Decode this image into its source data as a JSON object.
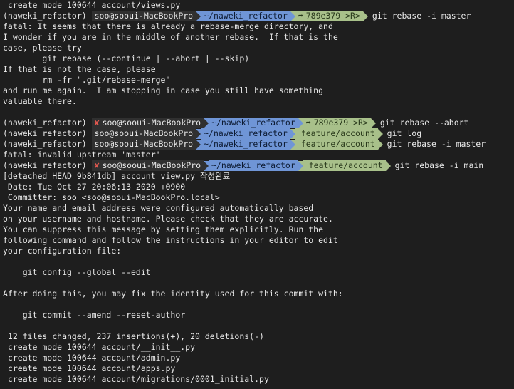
{
  "lines": [
    {
      "t": "text",
      "text": " create mode 100644 account/views.py"
    },
    {
      "t": "prompt",
      "env": "(naweki_refactor) ",
      "error": false,
      "user": "soo@sooui-MacBookPro",
      "dir": "~/naweki_refactor",
      "git": "789e379 >R>",
      "git_icon": "commit",
      "cmd": "git rebase -i master"
    },
    {
      "t": "text",
      "text": "fatal: It seems that there is already a rebase-merge directory, and"
    },
    {
      "t": "text",
      "text": "I wonder if you are in the middle of another rebase.  If that is the"
    },
    {
      "t": "text",
      "text": "case, please try"
    },
    {
      "t": "text",
      "text": "        git rebase (--continue | --abort | --skip)"
    },
    {
      "t": "text",
      "text": "If that is not the case, please"
    },
    {
      "t": "text",
      "text": "        rm -fr \".git/rebase-merge\""
    },
    {
      "t": "text",
      "text": "and run me again.  I am stopping in case you still have something"
    },
    {
      "t": "text",
      "text": "valuable there."
    },
    {
      "t": "text",
      "text": ""
    },
    {
      "t": "prompt",
      "env": "(naweki_refactor) ",
      "error": true,
      "user": "soo@sooui-MacBookPro",
      "dir": "~/naweki_refactor",
      "git": "789e379 >R>",
      "git_icon": "commit",
      "cmd": "git rebase --abort"
    },
    {
      "t": "prompt",
      "env": "(naweki_refactor) ",
      "error": false,
      "user": "soo@sooui-MacBookPro",
      "dir": "~/naweki_refactor",
      "git": "feature/account",
      "git_icon": "branch",
      "cmd": "git log"
    },
    {
      "t": "prompt",
      "env": "(naweki_refactor) ",
      "error": false,
      "user": "soo@sooui-MacBookPro",
      "dir": "~/naweki_refactor",
      "git": "feature/account",
      "git_icon": "branch",
      "cmd": "git rebase -i master"
    },
    {
      "t": "text",
      "text": "fatal: invalid upstream 'master'"
    },
    {
      "t": "prompt",
      "env": "(naweki_refactor) ",
      "error": true,
      "user": "soo@sooui-MacBookPro",
      "dir": "~/naweki_refactor",
      "git": "feature/account",
      "git_icon": "branch",
      "cmd": "git rebase -i main"
    },
    {
      "t": "text",
      "text": "[detached HEAD 9b841db] account view.py 작성완료"
    },
    {
      "t": "text",
      "text": " Date: Tue Oct 27 20:06:13 2020 +0900"
    },
    {
      "t": "text",
      "text": " Committer: soo <soo@sooui-MacBookPro.local>"
    },
    {
      "t": "text",
      "text": "Your name and email address were configured automatically based"
    },
    {
      "t": "text",
      "text": "on your username and hostname. Please check that they are accurate."
    },
    {
      "t": "text",
      "text": "You can suppress this message by setting them explicitly. Run the"
    },
    {
      "t": "text",
      "text": "following command and follow the instructions in your editor to edit"
    },
    {
      "t": "text",
      "text": "your configuration file:"
    },
    {
      "t": "text",
      "text": ""
    },
    {
      "t": "text",
      "text": "    git config --global --edit"
    },
    {
      "t": "text",
      "text": ""
    },
    {
      "t": "text",
      "text": "After doing this, you may fix the identity used for this commit with:"
    },
    {
      "t": "text",
      "text": ""
    },
    {
      "t": "text",
      "text": "    git commit --amend --reset-author"
    },
    {
      "t": "text",
      "text": ""
    },
    {
      "t": "text",
      "text": " 12 files changed, 237 insertions(+), 20 deletions(-)"
    },
    {
      "t": "text",
      "text": " create mode 100644 account/__init__.py"
    },
    {
      "t": "text",
      "text": " create mode 100644 account/admin.py"
    },
    {
      "t": "text",
      "text": " create mode 100644 account/apps.py"
    },
    {
      "t": "text",
      "text": " create mode 100644 account/migrations/0001_initial.py"
    }
  ],
  "colors": {
    "background": "#1e1e1e",
    "user_segment": "#303030",
    "dir_segment": "#6f95d6",
    "git_segment": "#a8c08a",
    "error_mark": "#e0584f"
  },
  "icons": {
    "error": "✘",
    "commit": "➦",
    "branch": ""
  }
}
